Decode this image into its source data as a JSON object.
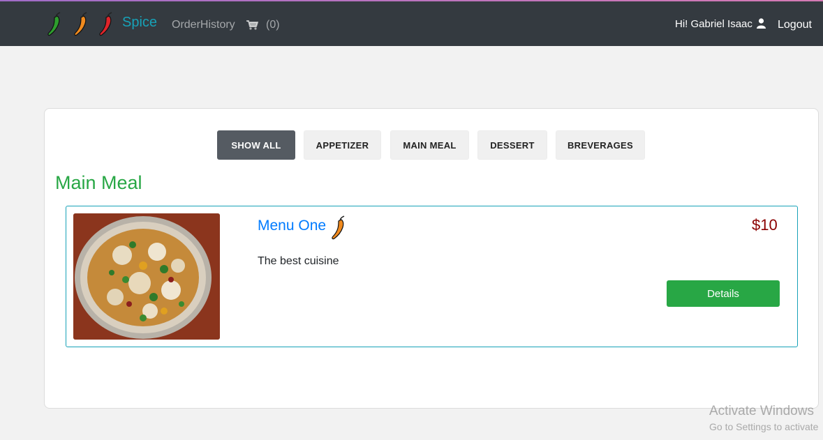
{
  "navbar": {
    "brand": "Spice",
    "order_history": "OrderHistory",
    "cart_count": "(0)",
    "greeting": "Hi! Gabriel Isaac",
    "logout": "Logout"
  },
  "filters": [
    {
      "label": "SHOW ALL",
      "active": true
    },
    {
      "label": "APPETIZER",
      "active": false
    },
    {
      "label": "MAIN MEAL",
      "active": false
    },
    {
      "label": "DESSERT",
      "active": false
    },
    {
      "label": "BREVERAGES",
      "active": false
    }
  ],
  "section": {
    "title": "Main Meal"
  },
  "items": [
    {
      "name": "Menu One",
      "description": "The best cuisine",
      "price": "$10",
      "details_label": "Details"
    }
  ],
  "watermark": {
    "line1": "Activate Windows",
    "line2": "Go to Settings to activate"
  },
  "colors": {
    "navbar": "#343a40",
    "brand": "#17a2b8",
    "section_title": "#28a745",
    "price": "#8b0000",
    "details_button": "#28a745"
  }
}
